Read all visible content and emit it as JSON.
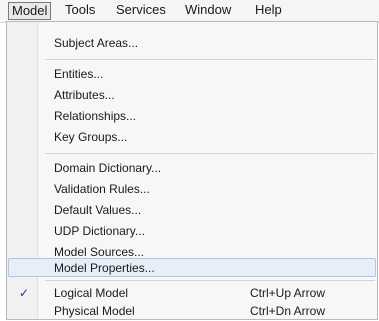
{
  "menubar": {
    "items": [
      {
        "label": "Model"
      },
      {
        "label": "Tools"
      },
      {
        "label": "Services"
      },
      {
        "label": "Window"
      },
      {
        "label": "Help"
      }
    ]
  },
  "menu": {
    "subject_areas": "Subject Areas...",
    "entities": "Entities...",
    "attributes": "Attributes...",
    "relationships": "Relationships...",
    "key_groups": "Key Groups...",
    "domain_dictionary": "Domain Dictionary...",
    "validation_rules": "Validation Rules...",
    "default_values": "Default Values...",
    "udp_dictionary": "UDP Dictionary...",
    "model_sources": "Model Sources...",
    "model_properties": "Model Properties...",
    "logical_model": {
      "label": "Logical Model",
      "shortcut": "Ctrl+Up Arrow",
      "checked": true
    },
    "physical_model": {
      "label": "Physical Model",
      "shortcut": "Ctrl+Dn Arrow",
      "checked": false
    },
    "check_glyph": "✓"
  }
}
